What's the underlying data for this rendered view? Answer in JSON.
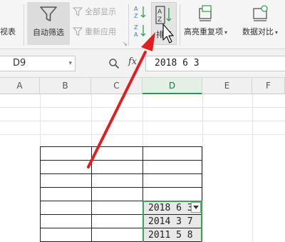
{
  "ribbon": {
    "view_fragment": "视表",
    "autofilter_label": "自动筛选",
    "show_all_label": "全部显示",
    "reapply_label": "重新应用",
    "sort_label": "排序",
    "highlight_dup_label": "高亮重复项",
    "data_compare_label": "数据对比"
  },
  "formula_bar": {
    "name_box": "D9",
    "fx": "fx",
    "formula": "2018 6 3"
  },
  "grid": {
    "columns": [
      "A",
      "B",
      "C",
      "D",
      "E",
      "F"
    ],
    "active_column": "D",
    "cells": [
      "2018 6 3",
      "2014 3 7",
      "2011 5 8"
    ]
  },
  "colors": {
    "accent_green": "#3aa356",
    "arrow_red": "#e02020",
    "ribbon_bg": "#f5f5f5"
  },
  "icons": [
    "filter-icon",
    "sort-asc-icon",
    "sort-desc-icon",
    "sort-icon",
    "highlight-duplicates-icon",
    "data-compare-icon",
    "zoom-icon",
    "mouse-cursor-icon",
    "filter-dropdown-icon"
  ]
}
